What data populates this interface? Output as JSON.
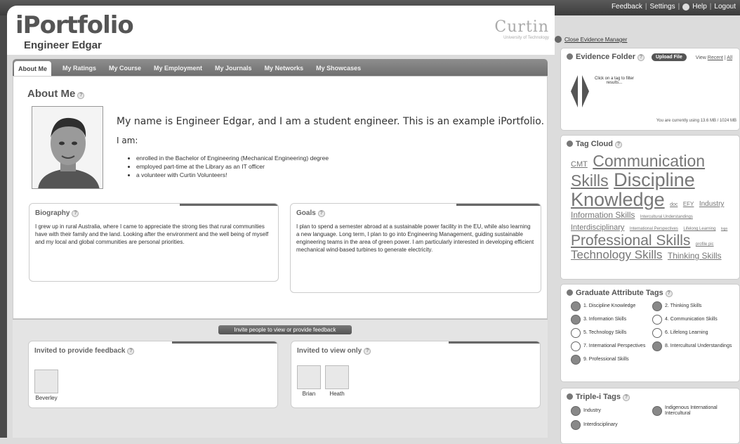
{
  "toplinks": [
    "Feedback",
    "Settings",
    "Help",
    "Logout"
  ],
  "brand": {
    "title": "iPortfolio",
    "owner": "Engineer Edgar"
  },
  "curtin": {
    "name": "Curtin",
    "sub": "University of Technology"
  },
  "tabs": [
    "About Me",
    "My Ratings",
    "My Course",
    "My Employment",
    "My Journals",
    "My Networks",
    "My Showcases"
  ],
  "about": {
    "heading": "About Me",
    "intro": "My name is Engineer Edgar, and I am a student engineer. This is an example iPortfolio.",
    "iam": "I am:",
    "bullets": [
      "enrolled in the Bachelor of Engineering (Mechanical Engineering) degree",
      "employed part-time at the Library as an IT officer",
      "a volunteer with Curtin Volunteers!"
    ]
  },
  "biography": {
    "title": "Biography",
    "text": "I grew up in rural Australia, where I came to appreciate the strong ties that rural communities have with their family and the land. Looking after the environment and the well being of myself and my local and global communities are personal priorities."
  },
  "goals": {
    "title": "Goals",
    "text": "I plan to spend a semester abroad at a sustainable power facility in the EU, while also learning a new language. Long term, I plan to go into Engineering Management, guiding sustainable engineering teams in the area of green power. I am particularly interested in developing efficient mechanical wind-based turbines to generate electricity."
  },
  "invite": {
    "button": "Invite people to view or provide feedback",
    "feedback_title": "Invited to provide feedback",
    "feedback_people": [
      "Beverley"
    ],
    "view_title": "Invited to view only",
    "view_people": [
      "Brian",
      "Heath"
    ]
  },
  "evidence": {
    "close": "Close Evidence Manager",
    "title": "Evidence Folder",
    "upload": "Upload File",
    "view_label": "View",
    "view_recent": "Recent",
    "view_all": "All",
    "hint": "Click on a tag to filter results...",
    "usage": "You are currently using 13.6 MB / 1024 MB"
  },
  "tagcloud": {
    "title": "Tag Cloud",
    "tags": [
      {
        "t": "CMT",
        "s": 11
      },
      {
        "t": "Communication Skills",
        "s": 23
      },
      {
        "t": "Discipline Knowledge",
        "s": 27
      },
      {
        "t": "doc",
        "s": 7
      },
      {
        "t": "EFY",
        "s": 8
      },
      {
        "t": "Industry",
        "s": 10
      },
      {
        "t": "Information Skills",
        "s": 12
      },
      {
        "t": "Intercultural Understandings",
        "s": 6
      },
      {
        "t": "Interdisciplinary",
        "s": 11
      },
      {
        "t": "International Perspectives",
        "s": 6
      },
      {
        "t": "Lifelong Learning",
        "s": 6
      },
      {
        "t": "logo",
        "s": 5
      },
      {
        "t": "Professional Skills",
        "s": 21
      },
      {
        "t": "profile pic",
        "s": 6
      },
      {
        "t": "Technology Skills",
        "s": 17
      },
      {
        "t": "Thinking Skills",
        "s": 12
      }
    ]
  },
  "graduate": {
    "title": "Graduate Attribute Tags",
    "items": [
      "1. Discipline Knowledge",
      "2. Thinking Skills",
      "3. Information Skills",
      "4. Communication Skills",
      "5. Technology Skills",
      "6. Lifelong Learning",
      "7. International Perspectives",
      "8. Intercultural Understandings",
      "9. Professional Skills"
    ]
  },
  "triple": {
    "title": "Triple-i Tags",
    "items": [
      "Industry",
      "Indigenous International Intercultural",
      "Interdisciplinary"
    ]
  }
}
